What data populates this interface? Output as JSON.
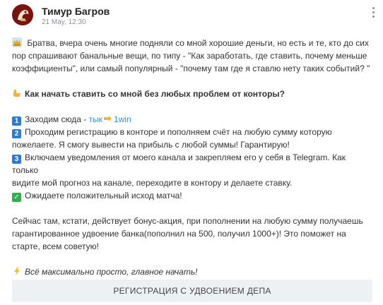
{
  "post": {
    "author": "Тимур Багров",
    "date": "21 May, 12:30",
    "intro_line1": " Братва, вчера очень многие подняли со мной хорошие деньги, но есть и те, кто до сих",
    "intro_line2": "пор спрашивают банальные вещи, по типу - \"Как заработать, где ставить, почему меньше",
    "intro_line3": "коэффициенты\", или самый популярный - \"почему там где я ставлю нету таких событий? \"",
    "heading": "Как начать ставить со мной без любых проблем от конторы?",
    "steps": {
      "s1_num": "1",
      "s1_text": "Заходим сюда - ",
      "s1_link": "тык",
      "s1_link2": "1win",
      "s2_num": "2",
      "s2_line1": "Проходим регистрацию в конторе и пополняем счёт на любую сумму которую",
      "s2_line2": "пожелаете. Я смогу вывести на прибыль с любой суммы! Гарантирую!",
      "s3_num": "3",
      "s3_line1": "Включаем уведомления от моего канала и закрепляем его у себя в Telegram. Как только",
      "s3_line2": "видите мой прогноз на канале, переходите в контору и делаете ставку.",
      "s4_check": "✓",
      "s4_text": "Ожидаете положительный исход матча!"
    },
    "bonus_line1": "Сейчас там, кстати, действует бонус-акция, при пополнении на любую сумму получаешь",
    "bonus_line2": "гарантированное удвоение банка(пополнил на 500, получил 1000+)! Это поможет на",
    "bonus_line3": "старте, всем советую!",
    "footer": "Всё максимально просто, главное начать!"
  },
  "cta": {
    "label": "РЕГИСТРАЦИЯ С УДВОЕНИЕМ ДЕПА"
  },
  "icons": {
    "avatar": "avatar-image",
    "menu": "kebab-menu-icon",
    "intro": "crown-emoji-icon",
    "heading": "pointing-hand-emoji-icon",
    "link": "pointing-hand-emoji-icon",
    "footer": "lightning-emoji-icon"
  },
  "colors": {
    "link": "#3a8fd8",
    "number_badge": "#2d7ad9",
    "check_badge": "#2fb14a",
    "button_bg": "#eef1f4"
  }
}
